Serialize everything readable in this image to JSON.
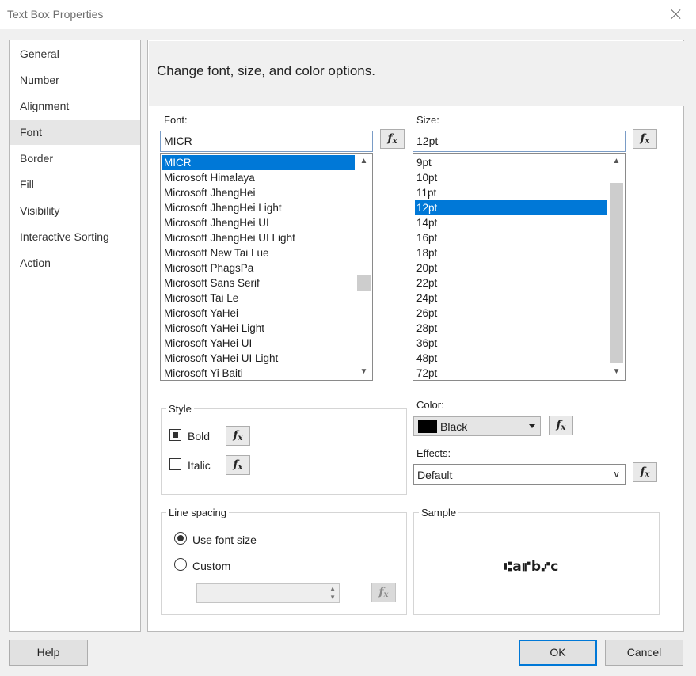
{
  "window": {
    "title": "Text Box Properties"
  },
  "sidebar": {
    "items": [
      {
        "label": "General"
      },
      {
        "label": "Number"
      },
      {
        "label": "Alignment"
      },
      {
        "label": "Font",
        "selected": true
      },
      {
        "label": "Border"
      },
      {
        "label": "Fill"
      },
      {
        "label": "Visibility"
      },
      {
        "label": "Interactive Sorting"
      },
      {
        "label": "Action"
      }
    ]
  },
  "header": {
    "text": "Change font, size, and color options."
  },
  "font": {
    "label": "Font:",
    "value": "MICR",
    "fx": "fx",
    "options": [
      "MICR",
      "Microsoft Himalaya",
      "Microsoft JhengHei",
      "Microsoft JhengHei Light",
      "Microsoft JhengHei UI",
      "Microsoft JhengHei UI Light",
      "Microsoft New Tai Lue",
      "Microsoft PhagsPa",
      "Microsoft Sans Serif",
      "Microsoft Tai Le",
      "Microsoft YaHei",
      "Microsoft YaHei Light",
      "Microsoft YaHei UI",
      "Microsoft YaHei UI Light",
      "Microsoft Yi Baiti"
    ],
    "selected": "MICR"
  },
  "size": {
    "label": "Size:",
    "value": "12pt",
    "fx": "fx",
    "options": [
      "9pt",
      "10pt",
      "11pt",
      "12pt",
      "14pt",
      "16pt",
      "18pt",
      "20pt",
      "22pt",
      "24pt",
      "26pt",
      "28pt",
      "36pt",
      "48pt",
      "72pt"
    ],
    "selected": "12pt"
  },
  "style": {
    "title": "Style",
    "bold": {
      "label": "Bold",
      "checked": true
    },
    "italic": {
      "label": "Italic",
      "checked": false
    }
  },
  "color": {
    "label": "Color:",
    "value": "Black",
    "swatch": "#000000"
  },
  "effects": {
    "label": "Effects:",
    "value": "Default"
  },
  "line_spacing": {
    "title": "Line spacing",
    "use_font_size": {
      "label": "Use font size",
      "selected": true
    },
    "custom": {
      "label": "Custom",
      "selected": false
    },
    "custom_value": ""
  },
  "sample": {
    "title": "Sample",
    "text": "⑆a⑈b⑇c"
  },
  "footer": {
    "help": "Help",
    "ok": "OK",
    "cancel": "Cancel"
  },
  "colors": {
    "accent": "#0078d7"
  }
}
